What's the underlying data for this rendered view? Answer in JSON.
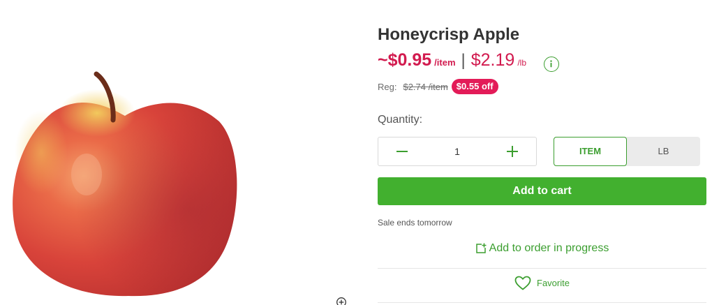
{
  "product": {
    "name": "Honeycrisp Apple",
    "image_alt": "red-apple"
  },
  "price": {
    "per_item": "~$0.95",
    "per_item_unit": "/item",
    "separator": "|",
    "per_lb": "$2.19",
    "per_lb_unit": "/lb",
    "info_icon": "info-icon"
  },
  "regular": {
    "label": "Reg:",
    "price": "$2.74 /item",
    "discount_badge": "$0.55 off"
  },
  "quantity": {
    "label": "Quantity:",
    "value": "1",
    "decrement_icon": "minus-icon",
    "increment_icon": "plus-icon"
  },
  "unit_toggle": {
    "options": [
      "ITEM",
      "LB"
    ],
    "selected": "ITEM"
  },
  "actions": {
    "add_to_cart": "Add to cart",
    "sale_note": "Sale ends tomorrow",
    "add_to_order": "Add to order in progress",
    "favorite": "Favorite"
  },
  "colors": {
    "sale_red": "#d21b4f",
    "badge_red": "#e31b58",
    "brand_green": "#42b02f",
    "link_green": "#3b9e2f"
  }
}
